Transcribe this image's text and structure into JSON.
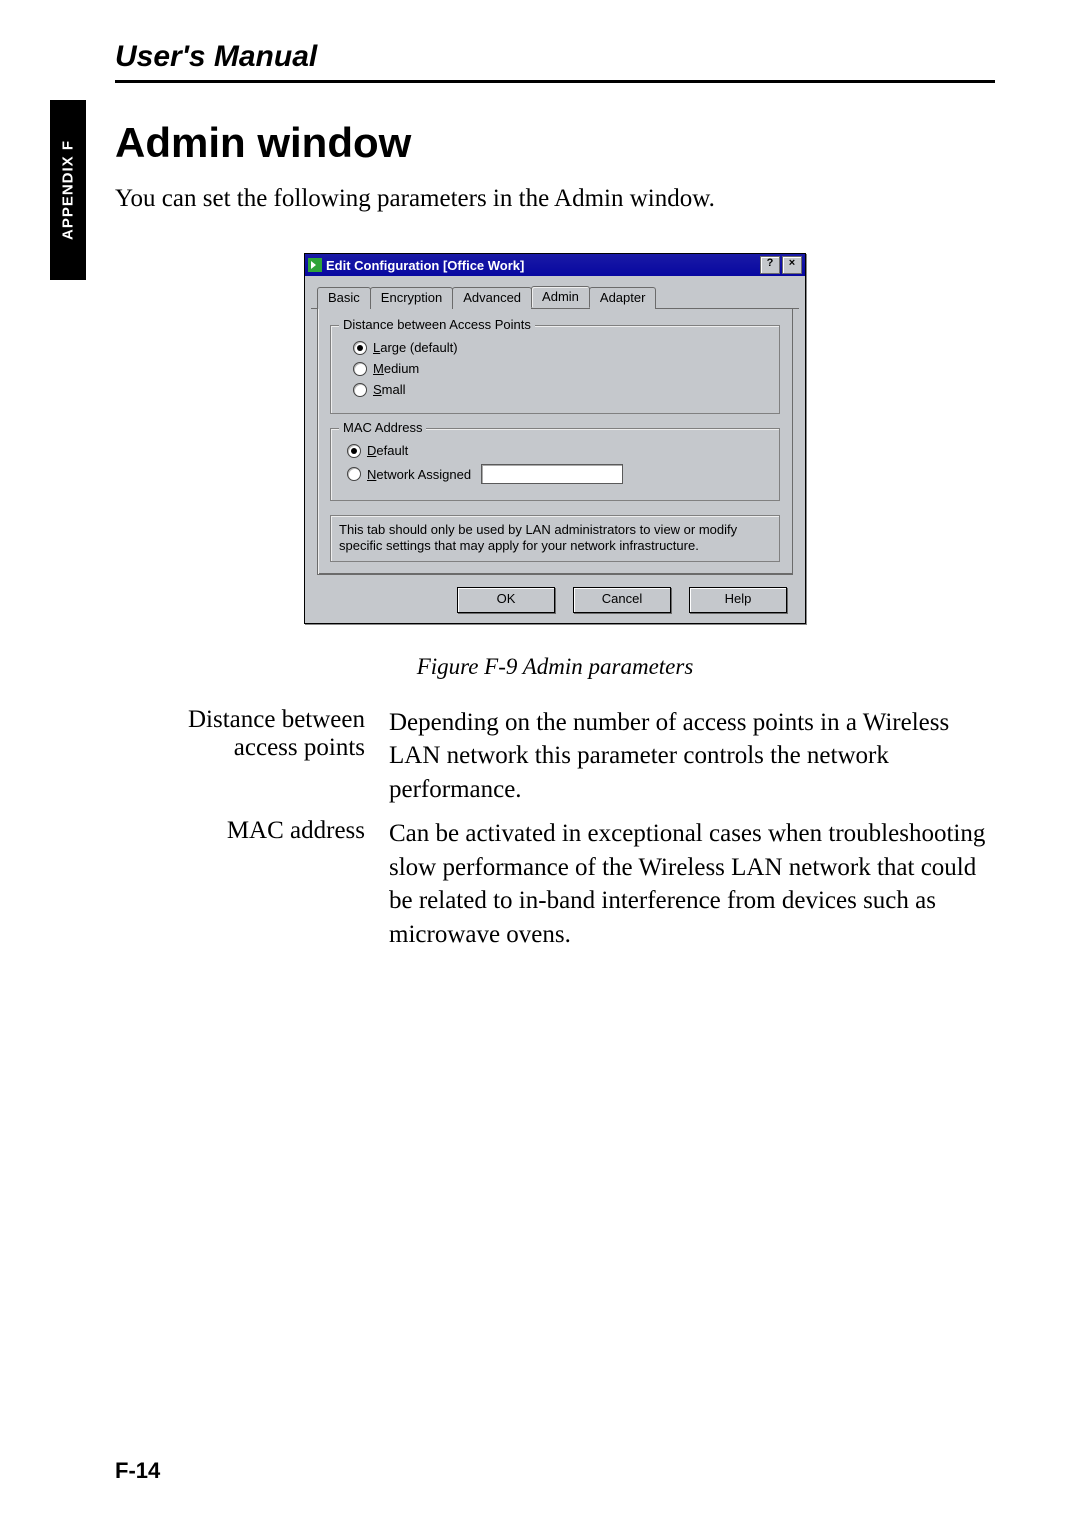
{
  "header": {
    "manual_title": "User's Manual"
  },
  "side_tab": "APPENDIX F",
  "section": {
    "title": "Admin window",
    "intro": "You can set the following parameters in the Admin window."
  },
  "dialog": {
    "titlebar": {
      "text": "Edit Configuration [Office Work]",
      "help_button": "?",
      "close_button": "×"
    },
    "tabs": [
      "Basic",
      "Encryption",
      "Advanced",
      "Admin",
      "Adapter"
    ],
    "active_tab_index": 3,
    "group_distance": {
      "legend": "Distance between Access Points",
      "options": [
        {
          "label": "Large (default)",
          "selected": true
        },
        {
          "label": "Medium",
          "selected": false
        },
        {
          "label": "Small",
          "selected": false
        }
      ]
    },
    "group_mac": {
      "legend": "MAC Address",
      "options": [
        {
          "label": "Default",
          "selected": true
        },
        {
          "label": "Network Assigned",
          "selected": false
        }
      ],
      "network_value": ""
    },
    "note": "This tab should only be used by LAN administrators to view or modify specific settings that may apply for your network infrastructure.",
    "buttons": {
      "ok": "OK",
      "cancel": "Cancel",
      "help": "Help"
    }
  },
  "figure_caption": "Figure F-9   Admin parameters",
  "definitions": [
    {
      "term": "Distance between access points",
      "desc": "Depending on the number of access points in a Wireless LAN network this parameter controls the network performance."
    },
    {
      "term": "MAC address",
      "desc": "Can be activated in exceptional cases when troubleshooting slow performance of the Wireless LAN network that could be related to in-band interference from devices such as microwave ovens."
    }
  ],
  "page_number": "F-14"
}
